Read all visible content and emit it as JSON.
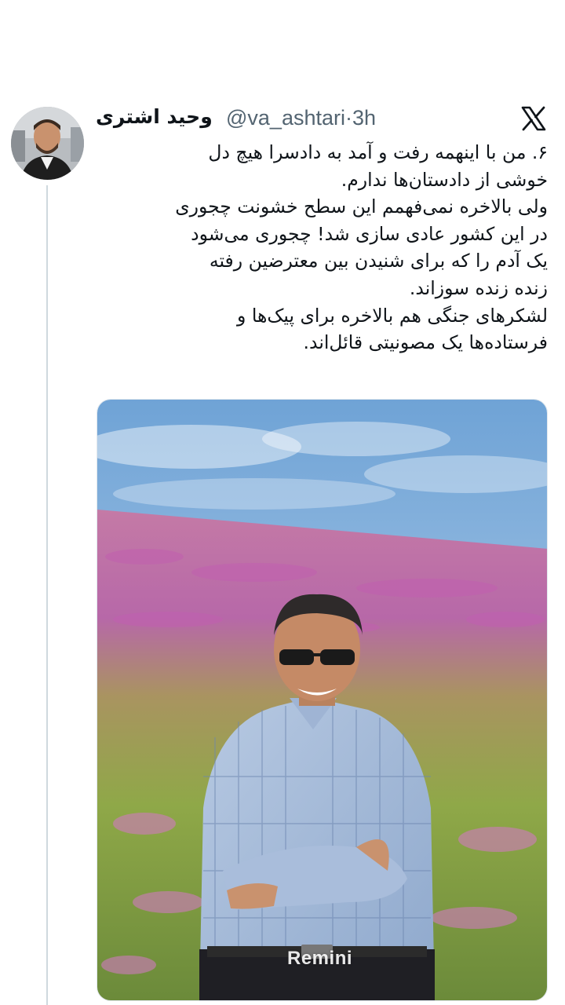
{
  "tweet": {
    "author_name": "وحید اشتری",
    "author_handle": "@va_ashtari",
    "separator": "·",
    "time_ago": "3h",
    "text_lines": [
      "۶. من با اینهمه رفت و آمد به دادسرا هیچ دل",
      "خوشی از دادستان‌ها ندارم.",
      "ولی بالاخره نمی‌فهمم این سطح خشونت چجوری",
      "در این کشور عادی سازی شد! چجوری می‌شود",
      "یک آدم را که برای شنیدن  بین معترضین رفته",
      "زنده زنده سوزاند.",
      "لشکرهای جنگی هم بالاخره برای پیک‌ها و",
      "فرستاده‌ها یک مصونیتی قائل‌اند."
    ]
  },
  "media": {
    "watermark": "Remini",
    "description_icon": "photo-man-in-flower-field"
  },
  "icons": {
    "platform_logo": "x-logo-icon"
  },
  "colors": {
    "text_primary": "#0f1419",
    "text_secondary": "#536471",
    "thread_line": "#cfd9de"
  }
}
